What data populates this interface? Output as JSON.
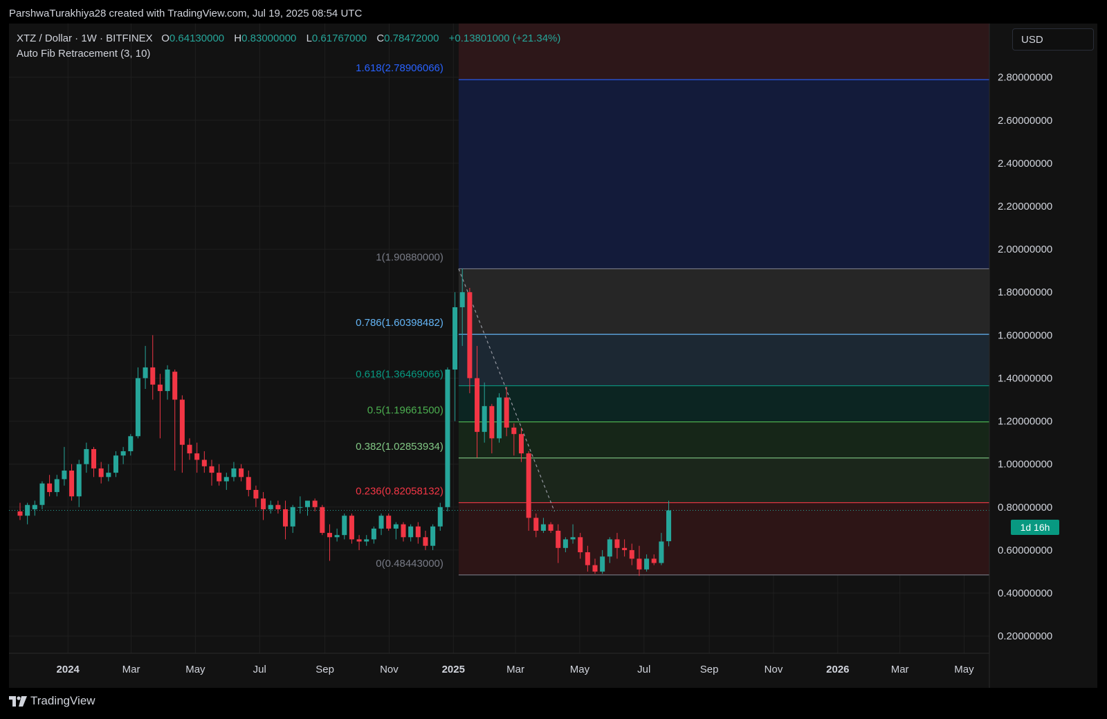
{
  "header": {
    "creator": "ParshwaTurakhiya28 created with TradingView.com, Jul 19, 2025 08:54 UTC"
  },
  "legend": {
    "symbol": "XTZ / Dollar · 1W · BITFINEX",
    "open_label": "O",
    "open": "0.64130000",
    "high_label": "H",
    "high": "0.83000000",
    "low_label": "L",
    "low": "0.61767000",
    "close_label": "C",
    "close": "0.78472000",
    "change": "+0.13801000 (+21.34%)",
    "indicator": "Auto Fib Retracement (3, 10)"
  },
  "currency": "USD",
  "countdown": "1d 16h",
  "footer": {
    "brand": "TradingView",
    "logo_icon": "tradingview-logo-icon"
  },
  "colors": {
    "up": "#26a69a",
    "down": "#f23645",
    "background": "#121212"
  },
  "chart_data": {
    "type": "candlestick",
    "timeframe": "1W",
    "y_axis": {
      "min": 0.12,
      "max": 3.05,
      "ticks": [
        {
          "value": 2.8,
          "label": "2.80000000"
        },
        {
          "value": 2.6,
          "label": "2.60000000"
        },
        {
          "value": 2.4,
          "label": "2.40000000"
        },
        {
          "value": 2.2,
          "label": "2.20000000"
        },
        {
          "value": 2.0,
          "label": "2.00000000"
        },
        {
          "value": 1.8,
          "label": "1.80000000"
        },
        {
          "value": 1.6,
          "label": "1.60000000"
        },
        {
          "value": 1.4,
          "label": "1.40000000"
        },
        {
          "value": 1.2,
          "label": "1.20000000"
        },
        {
          "value": 1.0,
          "label": "1.00000000"
        },
        {
          "value": 0.8,
          "label": "0.80000000"
        },
        {
          "value": 0.6,
          "label": "0.60000000"
        },
        {
          "value": 0.4,
          "label": "0.40000000"
        },
        {
          "value": 0.2,
          "label": "0.20000000"
        }
      ]
    },
    "x_axis": {
      "start": "2023-11-06",
      "end": "2026-05-25",
      "ticks": [
        {
          "date": "2024-01-01",
          "label": "2024",
          "bold": true
        },
        {
          "date": "2024-03-01",
          "label": "Mar"
        },
        {
          "date": "2024-05-01",
          "label": "May"
        },
        {
          "date": "2024-07-01",
          "label": "Jul"
        },
        {
          "date": "2024-09-01",
          "label": "Sep"
        },
        {
          "date": "2024-11-01",
          "label": "Nov"
        },
        {
          "date": "2025-01-01",
          "label": "2025",
          "bold": true
        },
        {
          "date": "2025-03-01",
          "label": "Mar"
        },
        {
          "date": "2025-05-01",
          "label": "May"
        },
        {
          "date": "2025-07-01",
          "label": "Jul"
        },
        {
          "date": "2025-09-01",
          "label": "Sep"
        },
        {
          "date": "2025-11-01",
          "label": "Nov"
        },
        {
          "date": "2026-01-01",
          "label": "2026",
          "bold": true
        },
        {
          "date": "2026-03-01",
          "label": "Mar"
        },
        {
          "date": "2026-05-01",
          "label": "May"
        }
      ]
    },
    "candles": [
      {
        "d": "2023-11-13",
        "o": 0.78,
        "h": 0.82,
        "l": 0.74,
        "c": 0.76
      },
      {
        "d": "2023-11-20",
        "o": 0.76,
        "h": 0.82,
        "l": 0.72,
        "c": 0.81
      },
      {
        "d": "2023-11-27",
        "o": 0.79,
        "h": 0.83,
        "l": 0.76,
        "c": 0.81
      },
      {
        "d": "2023-12-04",
        "o": 0.81,
        "h": 0.92,
        "l": 0.79,
        "c": 0.91
      },
      {
        "d": "2023-12-11",
        "o": 0.91,
        "h": 0.95,
        "l": 0.85,
        "c": 0.87
      },
      {
        "d": "2023-12-18",
        "o": 0.87,
        "h": 0.95,
        "l": 0.85,
        "c": 0.93
      },
      {
        "d": "2023-12-25",
        "o": 0.93,
        "h": 1.08,
        "l": 0.9,
        "c": 0.97
      },
      {
        "d": "2024-01-01",
        "o": 0.97,
        "h": 1.0,
        "l": 0.83,
        "c": 0.85
      },
      {
        "d": "2024-01-08",
        "o": 0.85,
        "h": 1.02,
        "l": 0.8,
        "c": 1.0
      },
      {
        "d": "2024-01-15",
        "o": 1.0,
        "h": 1.1,
        "l": 0.96,
        "c": 1.07
      },
      {
        "d": "2024-01-22",
        "o": 1.07,
        "h": 1.08,
        "l": 0.94,
        "c": 0.98
      },
      {
        "d": "2024-01-29",
        "o": 0.98,
        "h": 1.01,
        "l": 0.91,
        "c": 0.94
      },
      {
        "d": "2024-02-05",
        "o": 0.94,
        "h": 1.0,
        "l": 0.92,
        "c": 0.96
      },
      {
        "d": "2024-02-12",
        "o": 0.96,
        "h": 1.06,
        "l": 0.94,
        "c": 1.04
      },
      {
        "d": "2024-02-19",
        "o": 1.04,
        "h": 1.08,
        "l": 1.0,
        "c": 1.06
      },
      {
        "d": "2024-02-26",
        "o": 1.06,
        "h": 1.14,
        "l": 1.04,
        "c": 1.13
      },
      {
        "d": "2024-03-04",
        "o": 1.13,
        "h": 1.45,
        "l": 1.12,
        "c": 1.4
      },
      {
        "d": "2024-03-11",
        "o": 1.4,
        "h": 1.55,
        "l": 1.35,
        "c": 1.45
      },
      {
        "d": "2024-03-18",
        "o": 1.45,
        "h": 1.6,
        "l": 1.3,
        "c": 1.37
      },
      {
        "d": "2024-03-25",
        "o": 1.37,
        "h": 1.42,
        "l": 1.12,
        "c": 1.34
      },
      {
        "d": "2024-04-01",
        "o": 1.34,
        "h": 1.46,
        "l": 1.3,
        "c": 1.44
      },
      {
        "d": "2024-04-08",
        "o": 1.43,
        "h": 1.44,
        "l": 0.97,
        "c": 1.3
      },
      {
        "d": "2024-04-15",
        "o": 1.3,
        "h": 1.32,
        "l": 0.96,
        "c": 1.09
      },
      {
        "d": "2024-04-22",
        "o": 1.09,
        "h": 1.12,
        "l": 1.02,
        "c": 1.05
      },
      {
        "d": "2024-04-29",
        "o": 1.05,
        "h": 1.1,
        "l": 0.96,
        "c": 1.02
      },
      {
        "d": "2024-05-06",
        "o": 1.02,
        "h": 1.06,
        "l": 0.96,
        "c": 0.99
      },
      {
        "d": "2024-05-13",
        "o": 0.99,
        "h": 1.02,
        "l": 0.9,
        "c": 0.96
      },
      {
        "d": "2024-05-20",
        "o": 0.96,
        "h": 1.0,
        "l": 0.9,
        "c": 0.92
      },
      {
        "d": "2024-05-27",
        "o": 0.92,
        "h": 0.96,
        "l": 0.88,
        "c": 0.94
      },
      {
        "d": "2024-06-03",
        "o": 0.94,
        "h": 1.01,
        "l": 0.92,
        "c": 0.98
      },
      {
        "d": "2024-06-10",
        "o": 0.98,
        "h": 1.0,
        "l": 0.92,
        "c": 0.94
      },
      {
        "d": "2024-06-17",
        "o": 0.94,
        "h": 0.97,
        "l": 0.85,
        "c": 0.88
      },
      {
        "d": "2024-06-24",
        "o": 0.88,
        "h": 0.9,
        "l": 0.8,
        "c": 0.84
      },
      {
        "d": "2024-07-01",
        "o": 0.84,
        "h": 0.87,
        "l": 0.74,
        "c": 0.79
      },
      {
        "d": "2024-07-08",
        "o": 0.79,
        "h": 0.83,
        "l": 0.77,
        "c": 0.81
      },
      {
        "d": "2024-07-15",
        "o": 0.81,
        "h": 0.83,
        "l": 0.77,
        "c": 0.79
      },
      {
        "d": "2024-07-22",
        "o": 0.79,
        "h": 0.83,
        "l": 0.65,
        "c": 0.71
      },
      {
        "d": "2024-07-29",
        "o": 0.71,
        "h": 0.81,
        "l": 0.68,
        "c": 0.8
      },
      {
        "d": "2024-08-05",
        "o": 0.8,
        "h": 0.85,
        "l": 0.77,
        "c": 0.8
      },
      {
        "d": "2024-08-12",
        "o": 0.8,
        "h": 0.83,
        "l": 0.76,
        "c": 0.83
      },
      {
        "d": "2024-08-19",
        "o": 0.83,
        "h": 0.84,
        "l": 0.78,
        "c": 0.8
      },
      {
        "d": "2024-08-26",
        "o": 0.8,
        "h": 0.81,
        "l": 0.67,
        "c": 0.68
      },
      {
        "d": "2024-09-02",
        "o": 0.68,
        "h": 0.72,
        "l": 0.55,
        "c": 0.66
      },
      {
        "d": "2024-09-09",
        "o": 0.66,
        "h": 0.7,
        "l": 0.64,
        "c": 0.67
      },
      {
        "d": "2024-09-16",
        "o": 0.67,
        "h": 0.77,
        "l": 0.65,
        "c": 0.76
      },
      {
        "d": "2024-09-23",
        "o": 0.76,
        "h": 0.77,
        "l": 0.63,
        "c": 0.65
      },
      {
        "d": "2024-09-30",
        "o": 0.65,
        "h": 0.67,
        "l": 0.6,
        "c": 0.64
      },
      {
        "d": "2024-10-07",
        "o": 0.64,
        "h": 0.67,
        "l": 0.62,
        "c": 0.65
      },
      {
        "d": "2024-10-14",
        "o": 0.65,
        "h": 0.71,
        "l": 0.63,
        "c": 0.7
      },
      {
        "d": "2024-10-21",
        "o": 0.7,
        "h": 0.77,
        "l": 0.67,
        "c": 0.76
      },
      {
        "d": "2024-10-28",
        "o": 0.76,
        "h": 0.77,
        "l": 0.69,
        "c": 0.7
      },
      {
        "d": "2024-11-04",
        "o": 0.7,
        "h": 0.73,
        "l": 0.65,
        "c": 0.72
      },
      {
        "d": "2024-11-11",
        "o": 0.72,
        "h": 0.73,
        "l": 0.64,
        "c": 0.66
      },
      {
        "d": "2024-11-18",
        "o": 0.66,
        "h": 0.72,
        "l": 0.64,
        "c": 0.71
      },
      {
        "d": "2024-11-25",
        "o": 0.71,
        "h": 0.73,
        "l": 0.63,
        "c": 0.66
      },
      {
        "d": "2024-12-02",
        "o": 0.66,
        "h": 0.69,
        "l": 0.6,
        "c": 0.62
      },
      {
        "d": "2024-12-09",
        "o": 0.62,
        "h": 0.72,
        "l": 0.6,
        "c": 0.71
      },
      {
        "d": "2024-12-16",
        "o": 0.71,
        "h": 0.82,
        "l": 0.69,
        "c": 0.8
      },
      {
        "d": "2024-12-23",
        "o": 0.8,
        "h": 1.45,
        "l": 0.78,
        "c": 1.44
      },
      {
        "d": "2024-12-30",
        "o": 1.44,
        "h": 1.8,
        "l": 1.2,
        "c": 1.73
      },
      {
        "d": "2025-01-06",
        "o": 1.73,
        "h": 1.91,
        "l": 1.55,
        "c": 1.8
      },
      {
        "d": "2025-01-13",
        "o": 1.8,
        "h": 1.82,
        "l": 1.33,
        "c": 1.4
      },
      {
        "d": "2025-01-20",
        "o": 1.4,
        "h": 1.55,
        "l": 1.03,
        "c": 1.15
      },
      {
        "d": "2025-01-27",
        "o": 1.15,
        "h": 1.38,
        "l": 1.1,
        "c": 1.27
      },
      {
        "d": "2025-02-03",
        "o": 1.27,
        "h": 1.28,
        "l": 1.05,
        "c": 1.12
      },
      {
        "d": "2025-02-10",
        "o": 1.12,
        "h": 1.33,
        "l": 1.1,
        "c": 1.31
      },
      {
        "d": "2025-02-17",
        "o": 1.31,
        "h": 1.36,
        "l": 1.13,
        "c": 1.17
      },
      {
        "d": "2025-02-24",
        "o": 1.17,
        "h": 1.19,
        "l": 1.04,
        "c": 1.14
      },
      {
        "d": "2025-03-03",
        "o": 1.14,
        "h": 1.17,
        "l": 1.01,
        "c": 1.05
      },
      {
        "d": "2025-03-10",
        "o": 1.05,
        "h": 1.06,
        "l": 0.69,
        "c": 0.75
      },
      {
        "d": "2025-03-17",
        "o": 0.75,
        "h": 0.77,
        "l": 0.66,
        "c": 0.69
      },
      {
        "d": "2025-03-24",
        "o": 0.69,
        "h": 0.75,
        "l": 0.68,
        "c": 0.72
      },
      {
        "d": "2025-03-31",
        "o": 0.72,
        "h": 0.73,
        "l": 0.68,
        "c": 0.69
      },
      {
        "d": "2025-04-07",
        "o": 0.69,
        "h": 0.72,
        "l": 0.54,
        "c": 0.61
      },
      {
        "d": "2025-04-14",
        "o": 0.61,
        "h": 0.66,
        "l": 0.59,
        "c": 0.65
      },
      {
        "d": "2025-04-21",
        "o": 0.65,
        "h": 0.72,
        "l": 0.63,
        "c": 0.66
      },
      {
        "d": "2025-04-28",
        "o": 0.66,
        "h": 0.68,
        "l": 0.56,
        "c": 0.59
      },
      {
        "d": "2025-05-05",
        "o": 0.59,
        "h": 0.62,
        "l": 0.5,
        "c": 0.53
      },
      {
        "d": "2025-05-12",
        "o": 0.53,
        "h": 0.56,
        "l": 0.49,
        "c": 0.5
      },
      {
        "d": "2025-05-19",
        "o": 0.5,
        "h": 0.6,
        "l": 0.49,
        "c": 0.57
      },
      {
        "d": "2025-05-26",
        "o": 0.57,
        "h": 0.66,
        "l": 0.54,
        "c": 0.65
      },
      {
        "d": "2025-06-02",
        "o": 0.65,
        "h": 0.68,
        "l": 0.56,
        "c": 0.61
      },
      {
        "d": "2025-06-09",
        "o": 0.61,
        "h": 0.65,
        "l": 0.57,
        "c": 0.6
      },
      {
        "d": "2025-06-16",
        "o": 0.6,
        "h": 0.63,
        "l": 0.53,
        "c": 0.56
      },
      {
        "d": "2025-06-23",
        "o": 0.56,
        "h": 0.62,
        "l": 0.48,
        "c": 0.51
      },
      {
        "d": "2025-06-30",
        "o": 0.51,
        "h": 0.58,
        "l": 0.5,
        "c": 0.56
      },
      {
        "d": "2025-07-07",
        "o": 0.56,
        "h": 0.58,
        "l": 0.53,
        "c": 0.54
      },
      {
        "d": "2025-07-14",
        "o": 0.54,
        "h": 0.68,
        "l": 0.53,
        "c": 0.64
      },
      {
        "d": "2025-07-21",
        "o": 0.6413,
        "h": 0.83,
        "l": 0.61767,
        "c": 0.78472
      }
    ],
    "last_price": 0.78472,
    "fib": {
      "start_date": "2025-01-06",
      "extend_to": "2026-05-25",
      "trend_line": {
        "from": {
          "d": "2025-01-06",
          "v": 1.9088
        },
        "to": {
          "d": "2025-04-07",
          "v": 0.78
        }
      },
      "levels": [
        {
          "label": "1.618(2.78906066)",
          "value": 2.78906066,
          "color": "#2962ff",
          "fill": "#131b3a"
        },
        {
          "label": "1(1.90880000)",
          "value": 1.9088,
          "color": "#787b86",
          "fill": "#262626"
        },
        {
          "label": "0.786(1.60398482)",
          "value": 1.60398482,
          "color": "#64b5f6",
          "fill": "#1c2833"
        },
        {
          "label": "0.618(1.36469066)",
          "value": 1.36469066,
          "color": "#089981",
          "fill": "#0c2522"
        },
        {
          "label": "0.5(1.19661500)",
          "value": 1.196615,
          "color": "#4caf50",
          "fill": "#162618"
        },
        {
          "label": "0.382(1.02853934)",
          "value": 1.02853934,
          "color": "#81c784",
          "fill": "#1b261b"
        },
        {
          "label": "0.236(0.82058132)",
          "value": 0.82058132,
          "color": "#f23645",
          "fill": "#2d1516"
        },
        {
          "label": "0(0.48443000)",
          "value": 0.48443,
          "color": "#787b86",
          "fill": null
        }
      ]
    }
  }
}
